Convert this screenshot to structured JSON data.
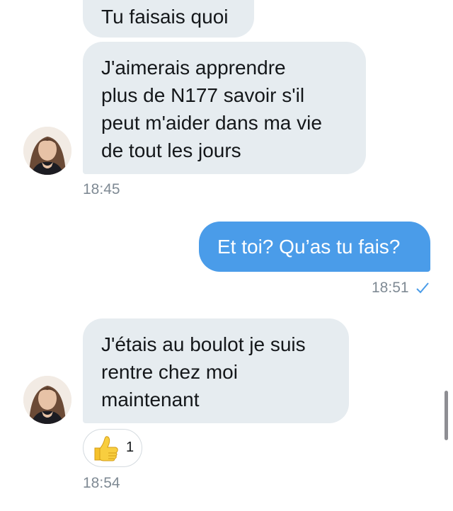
{
  "messages": [
    {
      "sender": "contact",
      "text": "Tu faisais quoi"
    },
    {
      "sender": "contact",
      "text": "J'aimerais apprendre\nplus de N177 savoir s'il\npeut m'aider dans ma vie\nde tout les jours",
      "time": "18:45"
    },
    {
      "sender": "me",
      "text": "Et toi? Qu’as tu fais?",
      "time": "18:51",
      "status_icon": "check-icon"
    },
    {
      "sender": "contact",
      "text": "J'étais au boulot je suis\nrentre chez moi\nmaintenant",
      "time": "18:54",
      "reaction": {
        "icon": "thumbs-up-icon",
        "count": "1"
      }
    }
  ],
  "colors": {
    "incoming_bubble": "#e6ecf0",
    "outgoing_bubble": "#4a9ce9",
    "timestamp": "#7f8a94",
    "read_check": "#4a9ce9"
  }
}
